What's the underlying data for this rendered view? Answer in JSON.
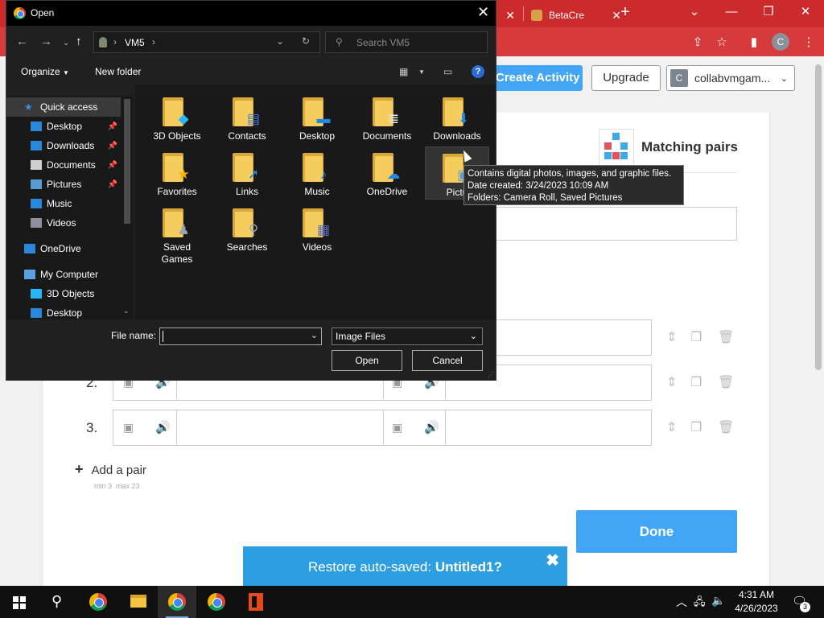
{
  "browser": {
    "tab_betacreator": "BetaCre",
    "account_initial": "C"
  },
  "page": {
    "create_activity_label": "Create Activity",
    "upgrade_label": "Upgrade",
    "account_label": "collabvmgam...",
    "account_avatar": "C",
    "template_name": "Matching pairs",
    "rows": [
      {
        "number": "2."
      },
      {
        "number": "3."
      }
    ],
    "add_pair_label": "Add a pair",
    "min_label": "min 3",
    "max_label": "max 23",
    "done_label": "Done",
    "restore_prefix": "Restore auto-saved: ",
    "restore_name": "Untitled1?"
  },
  "dialog": {
    "title": "Open",
    "path_segment": "VM5",
    "search_placeholder": "Search VM5",
    "organize_label": "Organize",
    "new_folder_label": "New folder",
    "nav": [
      {
        "label": "Quick access",
        "icon": "star-icon",
        "color": "#3a8ee6"
      },
      {
        "label": "Desktop",
        "icon": "desktop-icon",
        "color": "#2b88d8",
        "pinned": true
      },
      {
        "label": "Downloads",
        "icon": "download-icon",
        "color": "#2b88d8",
        "pinned": true
      },
      {
        "label": "Documents",
        "icon": "document-icon",
        "color": "#cfcfcf",
        "pinned": true
      },
      {
        "label": "Pictures",
        "icon": "picture-icon",
        "color": "#5b9bd5",
        "pinned": true
      },
      {
        "label": "Music",
        "icon": "music-icon",
        "color": "#2b88d8"
      },
      {
        "label": "Videos",
        "icon": "video-icon",
        "color": "#8a8fa0"
      },
      {
        "label": "OneDrive",
        "icon": "cloud-icon",
        "color": "#2b88d8"
      },
      {
        "label": "My Computer",
        "icon": "computer-icon",
        "color": "#5aa0e0"
      },
      {
        "label": "3D Objects",
        "icon": "cube-icon",
        "color": "#29b6f6"
      },
      {
        "label": "Desktop",
        "icon": "desktop-icon",
        "color": "#2b88d8"
      }
    ],
    "folders": [
      {
        "label": "3D Objects",
        "badge": "cube",
        "color": "#29b6f6"
      },
      {
        "label": "Contacts",
        "badge": "contact",
        "color": "#3b7dd8"
      },
      {
        "label": "Desktop",
        "badge": "desktop",
        "color": "#1e88e5"
      },
      {
        "label": "Documents",
        "badge": "doc",
        "color": "#e6e6e6"
      },
      {
        "label": "Downloads",
        "badge": "down",
        "color": "#1e88e5"
      },
      {
        "label": "Favorites",
        "badge": "star",
        "color": "#f4b400"
      },
      {
        "label": "Links",
        "badge": "link",
        "color": "#1e88e5"
      },
      {
        "label": "Music",
        "badge": "note",
        "color": "#1e88e5"
      },
      {
        "label": "OneDrive",
        "badge": "cloud",
        "color": "#1e88e5"
      },
      {
        "label": "Pictu",
        "badge": "pic",
        "color": "#5b9bd5"
      },
      {
        "label": "Saved\nGames",
        "badge": "chess",
        "color": "#9aa4ad"
      },
      {
        "label": "Searches",
        "badge": "search",
        "color": "#8fa9c0"
      },
      {
        "label": "Videos",
        "badge": "film",
        "color": "#5c6bc0"
      }
    ],
    "tooltip": {
      "line1": "Contains digital photos, images, and graphic files.",
      "line2": "Date created: 3/24/2023 10:09 AM",
      "line3": "Folders: Camera Roll, Saved Pictures"
    },
    "file_name_label": "File name:",
    "file_name_value": "",
    "file_type": "Image Files",
    "open_label": "Open",
    "cancel_label": "Cancel"
  },
  "taskbar": {
    "time": "4:31 AM",
    "date": "4/26/2023",
    "notification_count": "3"
  }
}
